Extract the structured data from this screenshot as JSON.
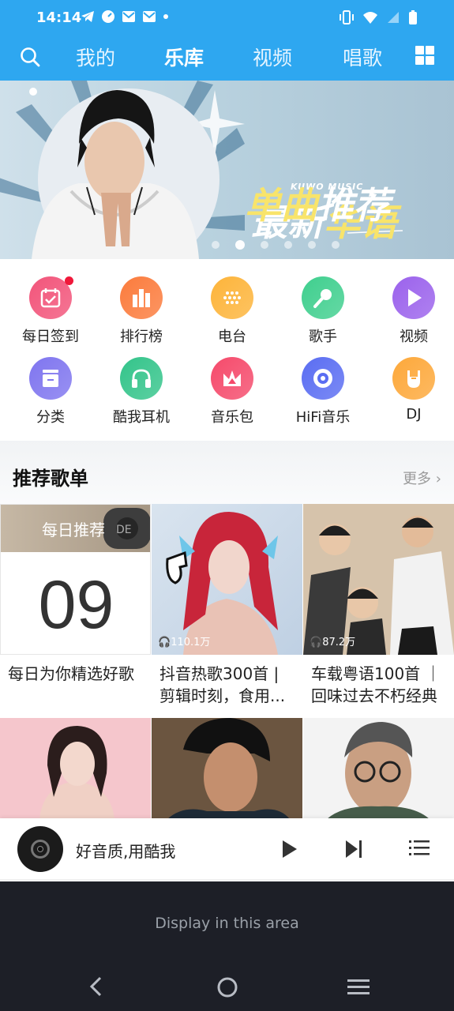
{
  "status": {
    "time": "14:14"
  },
  "nav": {
    "tabs": [
      {
        "label": "我的",
        "active": false
      },
      {
        "label": "乐库",
        "active": true
      },
      {
        "label": "视频",
        "active": false
      },
      {
        "label": "唱歌",
        "active": false
      }
    ]
  },
  "banner": {
    "brand": "KUWO MUSIC",
    "line1a": "最新",
    "line1b": "华语",
    "line2a": "单曲",
    "line2b": "推荐",
    "dot_count": 6,
    "active_dot": 1
  },
  "shortcuts": [
    {
      "label": "每日签到",
      "icon": "calendar-check-icon",
      "color": "#f2547a",
      "badge": true
    },
    {
      "label": "排行榜",
      "icon": "bar-chart-icon",
      "color": "#fb7b3c"
    },
    {
      "label": "电台",
      "icon": "radio-icon",
      "color": "#fdb43a"
    },
    {
      "label": "歌手",
      "icon": "microphone-icon",
      "color": "#3fcf8e"
    },
    {
      "label": "视频",
      "icon": "play-icon",
      "color": "#9b62ec"
    },
    {
      "label": "分类",
      "icon": "category-icon",
      "color": "#7f75ef"
    },
    {
      "label": "酷我耳机",
      "icon": "headphones-icon",
      "color": "#33c48a"
    },
    {
      "label": "音乐包",
      "icon": "crown-icon",
      "color": "#f54a6b"
    },
    {
      "label": "HiFi音乐",
      "icon": "vinyl-icon",
      "color": "#5a6df2"
    },
    {
      "label": "DJ",
      "icon": "rock-hand-icon",
      "color": "#fda83a"
    }
  ],
  "section": {
    "title": "推荐歌单",
    "more": "更多"
  },
  "playlists": [
    {
      "daily_label": "每日推荐",
      "day": "09",
      "caption": "每日为你精选好歌"
    },
    {
      "caption_line1": "抖音热歌300首 |",
      "caption_line2": "剪辑时刻，食用...",
      "plays": "110.1万"
    },
    {
      "caption_line1": "车载粤语100首 ｜",
      "caption_line2": "回味过去不朽经典",
      "plays": "87.2万"
    }
  ],
  "player": {
    "text": "好音质,用酷我"
  },
  "system": {
    "placeholder": "Display in this area"
  },
  "colors": {
    "accent": "#2ea7f0",
    "badge": "#f0183a"
  }
}
